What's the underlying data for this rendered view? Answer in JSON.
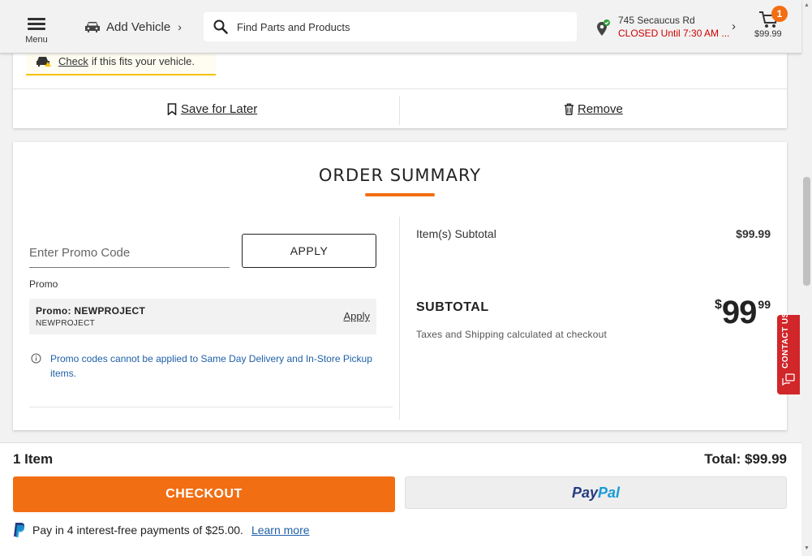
{
  "header": {
    "menu_label": "Menu",
    "add_vehicle_label": "Add Vehicle",
    "search_placeholder": "Find Parts and Products",
    "store_address": "745 Secaucus Rd",
    "store_status": "CLOSED Until 7:30 AM ...",
    "cart_count": "1",
    "cart_total": "$99.99"
  },
  "item_card": {
    "fit_check_link": "Check",
    "fit_check_text": "if this fits your vehicle.",
    "save_for_later": "Save for Later",
    "remove": "Remove"
  },
  "summary": {
    "title": "ORDER SUMMARY",
    "promo_placeholder": "Enter Promo Code",
    "apply_button": "APPLY",
    "promo_label": "Promo",
    "promo_name": "Promo: NEWPROJECT",
    "promo_code": "NEWPROJECT",
    "promo_apply": "Apply",
    "promo_note": "Promo codes cannot be applied to Same Day Delivery and In-Store Pickup items.",
    "items_subtotal_label": "Item(s) Subtotal",
    "items_subtotal_value": "$99.99",
    "subtotal_label": "SUBTOTAL",
    "subtotal_currency": "$",
    "subtotal_dollars": "99",
    "subtotal_cents": "99",
    "taxes_note": "Taxes and Shipping calculated at checkout"
  },
  "contact": {
    "label": "CONTACT US"
  },
  "bottom": {
    "item_count": "1 Item",
    "total": "Total: $99.99",
    "checkout": "CHECKOUT",
    "paypal_pay": "Pay",
    "paypal_pal": "Pal",
    "pay_in_4": "Pay in 4 interest-free payments of $25.00.",
    "learn_more": "Learn more"
  },
  "colors": {
    "accent_orange": "#f26e12",
    "closed_red": "#cc0000",
    "link_blue": "#1f5fa8",
    "contact_red": "#d1262a",
    "warning_yellow": "#f3c400"
  },
  "icons": {
    "menu": "hamburger-icon",
    "vehicle": "car-icon",
    "search": "search-icon",
    "store": "store-pin-check-icon",
    "cart": "cart-icon",
    "save": "bookmark-icon",
    "remove": "trash-icon",
    "info": "info-icon",
    "contact": "chat-icon",
    "paypal": "paypal-icon"
  }
}
